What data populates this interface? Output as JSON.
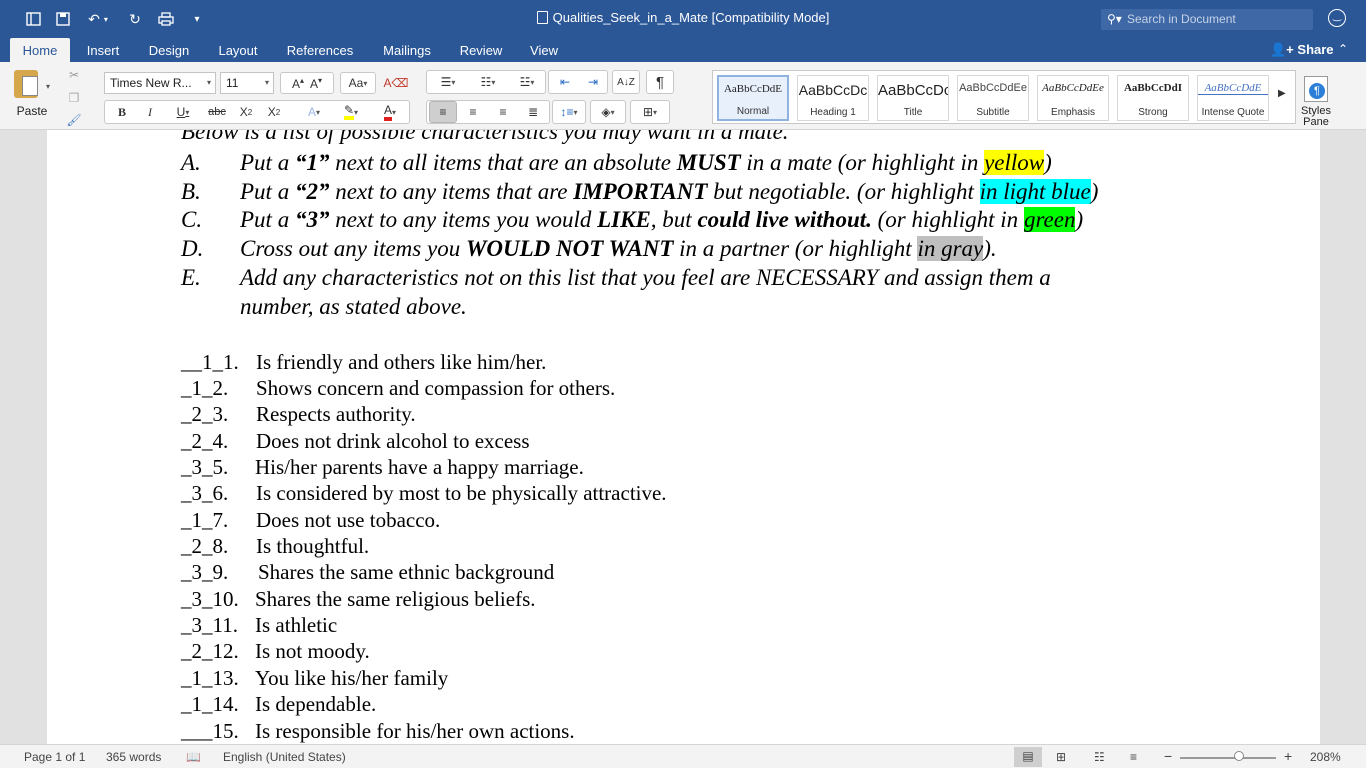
{
  "window": {
    "title": "Qualities_Seek_in_a_Mate [Compatibility Mode]",
    "search_placeholder": "Search in Document",
    "share_label": "Share"
  },
  "tabs": [
    {
      "label": "Home",
      "active": true
    },
    {
      "label": "Insert"
    },
    {
      "label": "Design"
    },
    {
      "label": "Layout"
    },
    {
      "label": "References"
    },
    {
      "label": "Mailings"
    },
    {
      "label": "Review"
    },
    {
      "label": "View"
    }
  ],
  "ribbon": {
    "paste_label": "Paste",
    "font_name": "Times New R...",
    "font_size": "11",
    "styles_pane_label": "Styles Pane",
    "styles": [
      {
        "sample": "AaBbCcDdE",
        "label": "Normal",
        "active": true
      },
      {
        "sample": "AaBbCcDc",
        "label": "Heading 1"
      },
      {
        "sample": "AaBbCcDc",
        "label": "Title"
      },
      {
        "sample": "AaBbCcDdEe",
        "label": "Subtitle"
      },
      {
        "sample": "AaBbCcDdEe",
        "label": "Emphasis"
      },
      {
        "sample": "AaBbCcDdI",
        "label": "Strong"
      },
      {
        "sample": "AaBbCcDdE",
        "label": "Intense Quote"
      }
    ]
  },
  "document": {
    "intro_partial": "Below is a list of possible characteristics you may want in a mate.",
    "instructions": [
      {
        "letter": "A.",
        "pre": "Put a ",
        "q": "“1”",
        "mid1": " next to all items that are an absolute ",
        "bold": "MUST",
        "mid2": " in a mate (or highlight in ",
        "hl": "yellow",
        "post": ")"
      },
      {
        "letter": "B.",
        "pre": "Put a ",
        "q": "“2”",
        "mid1": " next to any items that are ",
        "bold": "IMPORTANT",
        "mid2": " but negotiable. (or highlight ",
        "hl": "in light blue",
        "post": ")"
      },
      {
        "letter": "C.",
        "pre": "Put a ",
        "q": "“3”",
        "mid1": " next to any items you would ",
        "bold": "LIKE",
        "mid2": ", but ",
        "bold2": "could live without.",
        "mid3": " (or highlight in ",
        "hl": "green",
        "post": ")"
      },
      {
        "letter": "D.",
        "pre": "Cross out any items you ",
        "bold": "WOULD NOT WANT",
        "mid2": " in a partner (or highlight ",
        "hl": "in gray",
        "post": ")."
      },
      {
        "letter": "E.",
        "line1": "Add any characteristics not on this list that you feel are NECESSARY and assign them a",
        "line2": "number, as stated above."
      }
    ],
    "items": [
      {
        "num": "__1_1.",
        "text": "Is friendly and others like him/her."
      },
      {
        "num": "_1_2.",
        "text": "Shows concern and compassion for others."
      },
      {
        "num": "_2_3.",
        "text": "Respects authority."
      },
      {
        "num": "_2_4.",
        "text": "Does not drink alcohol to excess"
      },
      {
        "num": "_3_5.",
        "text": "His/her parents have a happy marriage."
      },
      {
        "num": "_3_6.",
        "text": "Is considered by most to be physically attractive."
      },
      {
        "num": "_1_7.",
        "text": "Does not use tobacco."
      },
      {
        "num": "_2_8.",
        "text": "Is thoughtful."
      },
      {
        "num": "_3_9.",
        "text": "Shares the same ethnic background"
      },
      {
        "num": "_3_10.",
        "text": "Shares the same religious beliefs."
      },
      {
        "num": "_3_11.",
        "text": "Is athletic"
      },
      {
        "num": "_2_12.",
        "text": "Is not moody."
      },
      {
        "num": "_1_13.",
        "text": "You like his/her family"
      },
      {
        "num": "_1_14.",
        "text": "Is dependable."
      },
      {
        "num": "___15.",
        "text": "Is responsible for his/her own actions."
      }
    ]
  },
  "status": {
    "page": "Page 1 of 1",
    "words": "365 words",
    "language": "English (United States)",
    "zoom": "208%",
    "zoom_minus": "−",
    "zoom_plus": "+"
  },
  "colors": {
    "titlebar": "#2b5797",
    "highlight_yellow": "#ffff00",
    "highlight_blue": "#00ffff",
    "highlight_green": "#00ff00",
    "highlight_gray": "#bfbfbf"
  }
}
